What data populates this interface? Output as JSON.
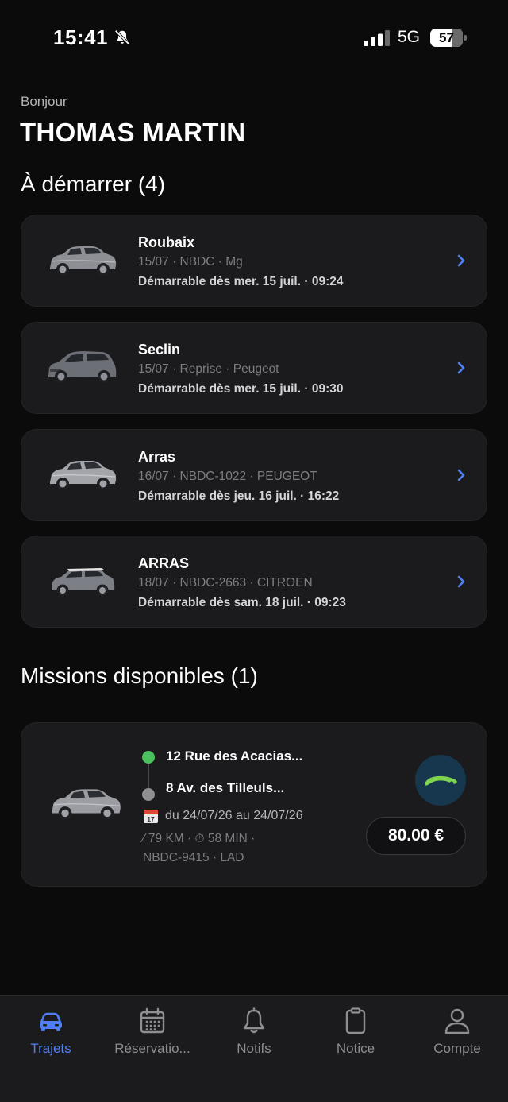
{
  "status_bar": {
    "time": "15:41",
    "network": "5G",
    "battery": "57"
  },
  "header": {
    "greeting": "Bonjour",
    "name": "THOMAS MARTIN"
  },
  "start_section": {
    "title": "À démarrer (4)",
    "trips": [
      {
        "title": "Roubaix",
        "subtitle": "15/07 · NBDC · Mg",
        "start": "Démarrable dès mer. 15 juil. · 09:24",
        "car": "silver-suv"
      },
      {
        "title": "Seclin",
        "subtitle": "15/07 · Reprise · Peugeot",
        "start": "Démarrable dès mer. 15 juil. · 09:30",
        "car": "grey-minivan"
      },
      {
        "title": "Arras",
        "subtitle": "16/07 · NBDC-1022 · PEUGEOT",
        "start": "Démarrable dès jeu. 16 juil. · 16:22",
        "car": "silver-suv"
      },
      {
        "title": "ARRAS",
        "subtitle": "18/07 · NBDC-2663 · CITROEN",
        "start": "Démarrable dès sam. 18 juil. · 09:23",
        "car": "mini-hatchback"
      }
    ]
  },
  "missions_section": {
    "title": "Missions disponibles (1)",
    "mission": {
      "from": "12 Rue des Acacias...",
      "to": "8 Av. des Tilleuls...",
      "dates": "du 24/07/26 au 24/07/26",
      "date_icon_day": "17",
      "meta_line1": "⁄ 79 KM · ⏱ 58 MIN ·",
      "meta_line2": "NBDC-9415 · LAD",
      "price": "80.00 €"
    }
  },
  "tab_bar": {
    "tabs": [
      {
        "label": "Trajets",
        "icon": "car-icon",
        "active": true
      },
      {
        "label": "Réservatio...",
        "icon": "calendar-icon",
        "active": false
      },
      {
        "label": "Notifs",
        "icon": "bell-icon",
        "active": false
      },
      {
        "label": "Notice",
        "icon": "clipboard-icon",
        "active": false
      },
      {
        "label": "Compte",
        "icon": "person-icon",
        "active": false
      }
    ]
  },
  "colors": {
    "background": "#0b0b0c",
    "card": "#1b1b1d",
    "accent": "#4f7ff0",
    "green": "#4bc15e",
    "logo_bg": "#16374e",
    "logo_fg": "#7fd44f"
  }
}
